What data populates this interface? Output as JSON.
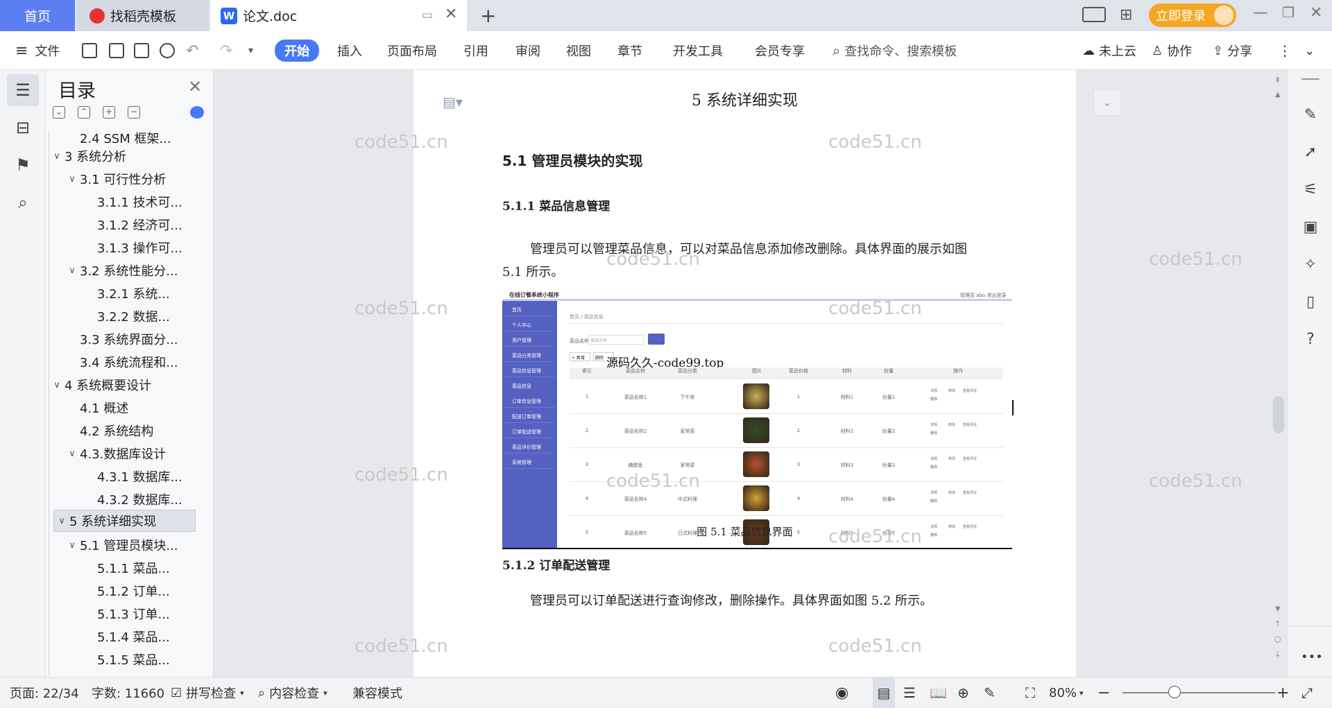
{
  "tabs": {
    "home": "首页",
    "templates": "找稻壳模板",
    "document": "论文.doc"
  },
  "login_label": "立即登录",
  "menu": {
    "file": "文件",
    "items": [
      "开始",
      "插入",
      "页面布局",
      "引用",
      "审阅",
      "视图",
      "章节",
      "开发工具",
      "会员专享"
    ],
    "search_placeholder": "查找命令、搜索模板",
    "cloud": "未上云",
    "collab": "协作",
    "share": "分享"
  },
  "toc": {
    "title": "目录",
    "items": [
      {
        "label": "2.4 SSM 框架..."
      },
      {
        "label": "3 系统分析"
      },
      {
        "label": "3.1 可行性分析"
      },
      {
        "label": "3.1.1 技术可..."
      },
      {
        "label": "3.1.2 经济可..."
      },
      {
        "label": "3.1.3 操作可..."
      },
      {
        "label": "3.2 系统性能分..."
      },
      {
        "label": "3.2.1 系统..."
      },
      {
        "label": "3.2.2 数据..."
      },
      {
        "label": "3.3 系统界面分..."
      },
      {
        "label": "3.4 系统流程和..."
      },
      {
        "label": "4 系统概要设计"
      },
      {
        "label": "4.1 概述"
      },
      {
        "label": "4.2 系统结构"
      },
      {
        "label": "4.3.数据库设计"
      },
      {
        "label": "4.3.1 数据库..."
      },
      {
        "label": "4.3.2 数据库..."
      },
      {
        "label": "5 系统详细实现"
      },
      {
        "label": "5.1  管理员模块..."
      },
      {
        "label": "5.1.1  菜品..."
      },
      {
        "label": "5.1.2  订单..."
      },
      {
        "label": "5.1.3  订单..."
      },
      {
        "label": "5.1.4  菜品..."
      },
      {
        "label": "5.1.5  菜品..."
      }
    ]
  },
  "doc": {
    "chapter": "5 系统详细实现",
    "section": "5.1  管理员模块的实现",
    "sub1": "5.1.1  菜品信息管理",
    "para1a": "管理员可以管理菜品信息，可以对菜品信息添加修改删除。具体界面的展示如图",
    "para1b": "5.1 所示。",
    "fig_caption": "图 5.1  菜品信息界面",
    "sub2": "5.1.2  订单配送管理",
    "para2": "管理员可以订单配送进行查询修改，删除操作。具体界面如图 5.2 所示。",
    "overlay": "源码久久-code99.top"
  },
  "watermark": "code51.cn",
  "figure": {
    "app_title": "在线订餐系统小程序",
    "top_right": "管理员 abo    退出登录",
    "breadcrumb": "首页  /  菜品信息",
    "search_label": "菜品名称",
    "search_placeholder": "菜品名称",
    "add_btn": "+ 新增",
    "del_btn": "删除",
    "sidebar": [
      "首页",
      "个人中心",
      "用户管理",
      "菜品分类管理",
      "菜品信息管理",
      "菜品信息",
      "订单信息管理",
      "配送订单管理",
      "订单配送管理",
      "菜品评价管理",
      "系统管理"
    ],
    "columns": [
      "索引",
      "菜品名称",
      "菜品分类",
      "图片",
      "菜品价格",
      "材料",
      "份量",
      "操作"
    ],
    "rows": [
      {
        "idx": "1",
        "name": "菜品名称1",
        "cat": "下午茶",
        "price": "1",
        "mat": "材料1",
        "amt": "份量1"
      },
      {
        "idx": "2",
        "name": "菜品名称2",
        "cat": "家常菜",
        "price": "2",
        "mat": "材料2",
        "amt": "份量2"
      },
      {
        "idx": "3",
        "name": "腌腊鱼",
        "cat": "家常菜",
        "price": "3",
        "mat": "材料3",
        "amt": "份量3"
      },
      {
        "idx": "4",
        "name": "菜品名称4",
        "cat": "中式料理",
        "price": "4",
        "mat": "材料4",
        "amt": "份量4"
      },
      {
        "idx": "5",
        "name": "菜品名称5",
        "cat": "日式料理",
        "price": "5",
        "mat": "材料5",
        "amt": "份量5"
      }
    ],
    "ops": [
      "详情",
      "修改",
      "查看评论",
      "删除"
    ]
  },
  "status": {
    "page": "页面: 22/34",
    "words": "字数: 11660",
    "spell": "拼写检查",
    "content_check": "内容检查",
    "compat": "兼容模式",
    "zoom": "80%"
  },
  "colors": {
    "accent": "#4879f5",
    "figure_sidebar": "#5461c0",
    "login": "#f5a623"
  }
}
